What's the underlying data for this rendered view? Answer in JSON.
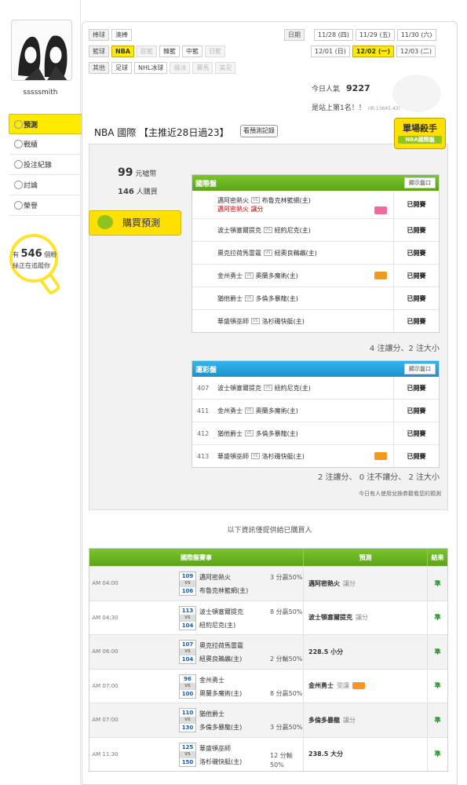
{
  "user": {
    "name": "sssssmith"
  },
  "menu": [
    {
      "label": "預測",
      "icon": "gear-icon",
      "active": true
    },
    {
      "label": "戰績",
      "icon": "chat-icon"
    },
    {
      "label": "投注紀錄",
      "icon": "circle-icon"
    },
    {
      "label": "討論",
      "icon": "edit-icon"
    },
    {
      "label": "榮譽",
      "icon": "medal-icon"
    }
  ],
  "fans": {
    "prefix": "有",
    "count": "546",
    "suffix": "個粉",
    "line2": "絲正在追蹤你"
  },
  "filters": {
    "rows": [
      {
        "cat": "棒球",
        "items": [
          {
            "label": "澳棒"
          }
        ]
      },
      {
        "cat": "籃球",
        "items": [
          {
            "label": "NBA",
            "selected": true
          },
          {
            "label": "歐籃",
            "disabled": true
          },
          {
            "label": "韓籃"
          },
          {
            "label": "中籃"
          },
          {
            "label": "日籃",
            "disabled": true
          }
        ]
      },
      {
        "cat": "其他",
        "items": [
          {
            "label": "足球"
          },
          {
            "label": "NHL冰球"
          },
          {
            "label": "俄冰",
            "disabled": true
          },
          {
            "label": "賽馬",
            "disabled": true
          },
          {
            "label": "美足",
            "disabled": true
          }
        ]
      }
    ],
    "date_label": "日期",
    "dates_row1": [
      {
        "label": "11/28 (四)"
      },
      {
        "label": "11/29 (五)"
      },
      {
        "label": "11/30 (六)"
      }
    ],
    "dates_row2": [
      {
        "label": "12/01 (日)"
      },
      {
        "label": "12/02 (一)",
        "selected": true
      },
      {
        "label": "12/03 (二)"
      }
    ]
  },
  "stats": {
    "visits_label": "今日人氣",
    "visits": "9227",
    "rank": "是站上第1名！！",
    "rank_small": "(IR:13645.43)"
  },
  "prediction": {
    "title": "NBA 國際 【主推近28日過23】",
    "history_button": "看預測記錄",
    "badge": "單場殺手",
    "badge_sub": "NBA國際盤",
    "price": "99",
    "price_unit": "元噓幣",
    "buyers": "146",
    "buyers_unit": "人購買",
    "buy_button": "購買預測",
    "intl": {
      "title": "國際盤",
      "button": "顯示盤口",
      "rows": [
        {
          "away": "邁阿密熱火",
          "home": "布魯克林籃網(主)",
          "pick": "邁阿密熱火  讓分",
          "icon": "pink",
          "status": "已開賽"
        },
        {
          "away": "波士頓塞爾提克",
          "home": "紐約尼克(主)",
          "status": "已開賽"
        },
        {
          "away": "奧克拉荷馬雷霆",
          "home": "紐奧良鵜鶘(主)",
          "status": "已開賽"
        },
        {
          "away": "金州勇士",
          "home": "奧蘭多魔術(主)",
          "icon": "orange",
          "status": "已開賽"
        },
        {
          "away": "猶他爵士",
          "home": "多倫多暴龍(主)",
          "status": "已開賽"
        },
        {
          "away": "華盛頓巫師",
          "home": "洛杉磯快艇(主)",
          "status": "已開賽"
        }
      ],
      "summary": "4 注讓分、2 注大小"
    },
    "lottery": {
      "title": "運彩盤",
      "button": "顯示盤口",
      "rows": [
        {
          "num": "407",
          "away": "波士頓塞爾提克",
          "home": "紐約尼克(主)",
          "status": "已開賽"
        },
        {
          "num": "411",
          "away": "金州勇士",
          "home": "奧蘭多魔術(主)",
          "status": "已開賽"
        },
        {
          "num": "412",
          "away": "猶他爵士",
          "home": "多倫多暴龍(主)",
          "status": "已開賽"
        },
        {
          "num": "413",
          "away": "華盛頓巫師",
          "home": "洛杉磯快艇(主)",
          "icon": "orange",
          "status": "已開賽"
        }
      ],
      "summary": "2 注讓分、 0 注不讓分、 2 注大小"
    },
    "note": "今日有人使用兌換券觀看您的預測"
  },
  "info_text": "以下資訊僅提供給已購買人",
  "games": {
    "headers": [
      "國際盤賽事",
      "預測",
      "結果"
    ],
    "rows": [
      {
        "time": "AM 04:00",
        "n1": "109",
        "n2": "106",
        "team_a": "邁阿密熱火",
        "team_b": "布魯克林籃網(主)",
        "spread": "3 分贏50%",
        "spread_row": "a",
        "pick": "邁阿密熱火",
        "pick_note": "讓分",
        "result": "準"
      },
      {
        "time": "AM 04:30",
        "n1": "113",
        "n2": "104",
        "team_a": "波士頓塞爾提克",
        "team_b": "紐約尼克(主)",
        "spread": "8 分贏50%",
        "spread_row": "a",
        "pick": "波士頓塞爾提克",
        "pick_note": "讓分",
        "result": "準"
      },
      {
        "time": "AM 06:00",
        "n1": "107",
        "n2": "104",
        "team_a": "奧克拉荷馬雷霆",
        "team_b": "紐奧良鵜鶘(主)",
        "spread": "2 分輸50%",
        "spread_row": "b",
        "pick": "228.5 小分",
        "pick_note": "",
        "result": "準"
      },
      {
        "time": "AM 07:00",
        "n1": "96",
        "n2": "100",
        "team_a": "金州勇士",
        "team_b": "奧蘭多魔術(主)",
        "spread": "8 分贏50%",
        "spread_row": "b",
        "pick": "金州勇士",
        "pick_note": "受讓",
        "pick_icon": true,
        "result": "準"
      },
      {
        "time": "AM 07:00",
        "n1": "110",
        "n2": "130",
        "team_a": "猶他爵士",
        "team_b": "多倫多暴龍(主)",
        "spread": "3 分贏50%",
        "spread_row": "b",
        "pick": "多倫多暴龍",
        "pick_note": "讓分",
        "result": "準"
      },
      {
        "time": "AM 11:30",
        "n1": "125",
        "n2": "150",
        "team_a": "華盛頓巫師",
        "team_b": "洛杉磯快艇(主)",
        "spread": "12 分輸 50%",
        "spread_row": "mid",
        "pick": "238.5 大分",
        "pick_note": "",
        "result": "準"
      }
    ]
  },
  "colors": {
    "accent": "#ffea00",
    "green": "#6bb422",
    "blue": "#2aa5de",
    "red": "#d00000"
  }
}
